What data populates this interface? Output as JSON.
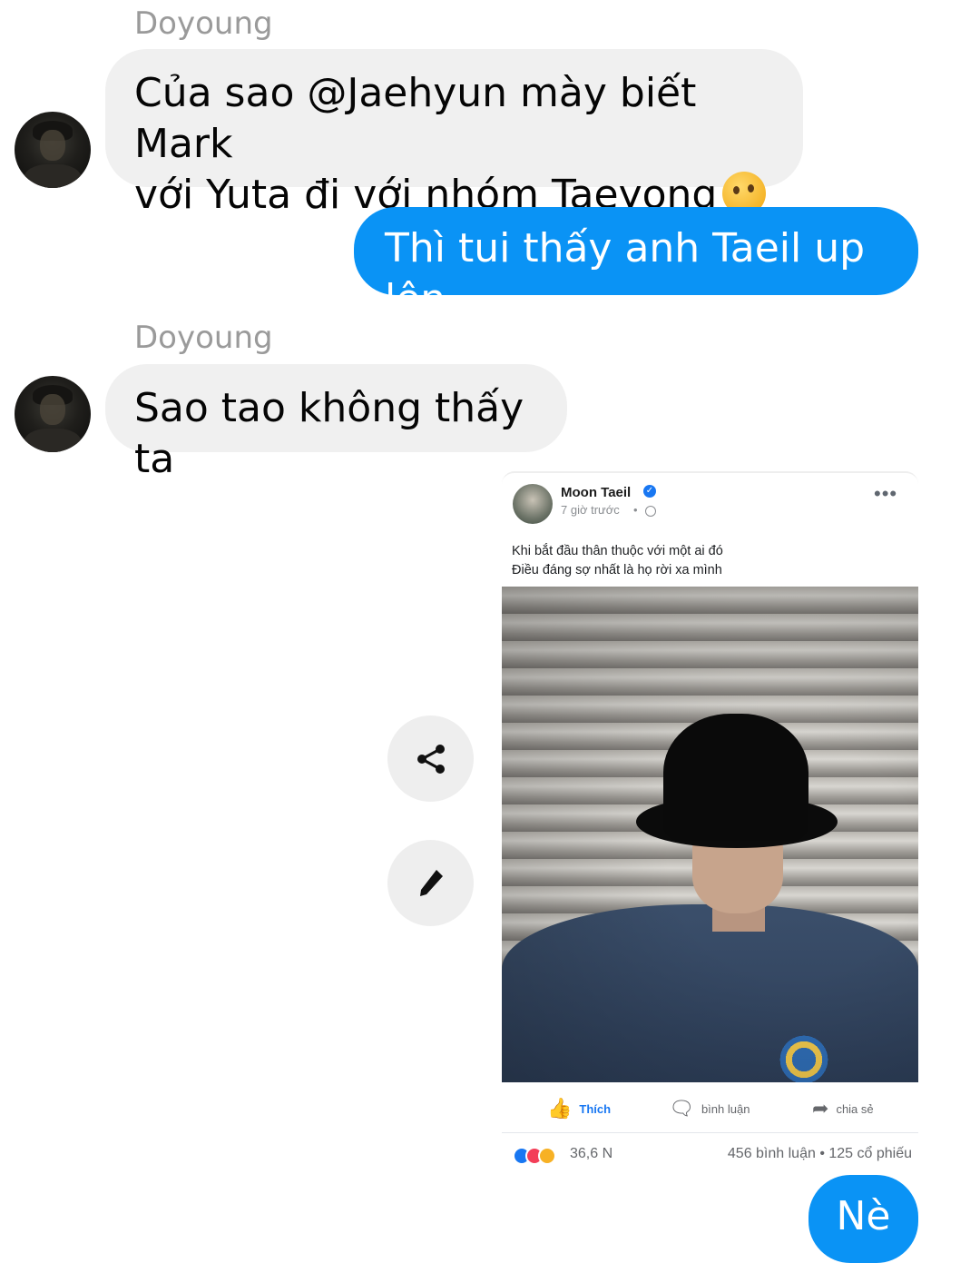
{
  "messages": [
    {
      "sender": "Doyoung",
      "text": "Của sao @Jaehyun mày biết Mark\nvới Yuta đi với nhóm Taeyong",
      "emoji": "thinking-face-icon"
    },
    {
      "text": "Thì tui thấy anh Taeil up lên"
    },
    {
      "sender": "Doyoung",
      "text": "Sao tao không thấy ta"
    },
    {
      "text": "Nè"
    }
  ],
  "shared_post": {
    "author": "Moon Taeil",
    "time": "7 giờ trước",
    "dot": "•",
    "more": "•••",
    "caption_line1": "Khi bắt đầu thân thuộc với một ai đó",
    "caption_line2": "Điều đáng sợ nhất là họ rời xa mình",
    "like_label": "Thích",
    "comment_label": "bình luận",
    "share_label": "chia sẻ",
    "reactions_count": "36,6 N",
    "comments_shares": "456  bình luận • 125  cổ phiếu"
  },
  "colors": {
    "outgoing_bubble": "#0a93f5",
    "incoming_bubble": "#f0f0f0",
    "facebook_blue": "#1877f2"
  }
}
